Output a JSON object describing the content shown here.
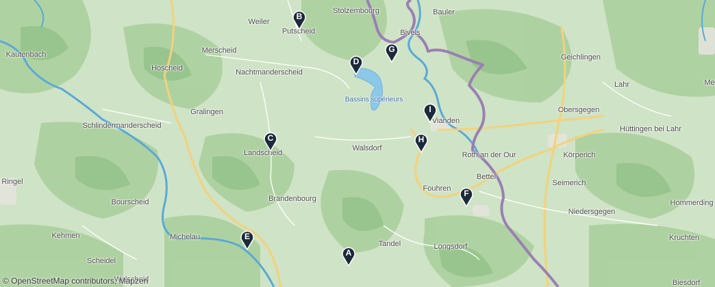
{
  "places": [
    {
      "key": "stolzembourg",
      "name": "Stolzembourg"
    },
    {
      "key": "bauler",
      "name": "Bauler"
    },
    {
      "key": "weiler",
      "name": "Weiler"
    },
    {
      "key": "putscheid",
      "name": "Putscheid"
    },
    {
      "key": "bivels",
      "name": "Bivels"
    },
    {
      "key": "kautenbach",
      "name": "Kautenbach"
    },
    {
      "key": "merscheid",
      "name": "Merscheid"
    },
    {
      "key": "hoscheid",
      "name": "Hoscheid"
    },
    {
      "key": "nachtmanderscheid",
      "name": "Nachtmanderscheid"
    },
    {
      "key": "geichlingen",
      "name": "Geichlingen"
    },
    {
      "key": "lahr",
      "name": "Lahr"
    },
    {
      "key": "bassins",
      "name": "Bassins supérieurs"
    },
    {
      "key": "gralingen",
      "name": "Gralingen"
    },
    {
      "key": "vianden",
      "name": "Vianden"
    },
    {
      "key": "obersgegen",
      "name": "Obersgegen"
    },
    {
      "key": "schlindermanderscheid",
      "name": "Schlindermanderscheid"
    },
    {
      "key": "huttingen",
      "name": "Hüttingen bei Lahr"
    },
    {
      "key": "walsdorf",
      "name": "Walsdorf"
    },
    {
      "key": "landscheid",
      "name": "Landscheid"
    },
    {
      "key": "roth",
      "name": "Roth an der Our"
    },
    {
      "key": "korperich",
      "name": "Körperich"
    },
    {
      "key": "ringel",
      "name": "Ringel"
    },
    {
      "key": "bettel",
      "name": "Bettel"
    },
    {
      "key": "fouhren",
      "name": "Fouhren"
    },
    {
      "key": "seimerich",
      "name": "Seimerich"
    },
    {
      "key": "brandenbourg",
      "name": "Brandenbourg"
    },
    {
      "key": "bourscheid",
      "name": "Bourscheid"
    },
    {
      "key": "hommerding",
      "name": "Hommerding"
    },
    {
      "key": "niedersgegen",
      "name": "Niedersgegen"
    },
    {
      "key": "kehmen",
      "name": "Kehmen"
    },
    {
      "key": "michelau",
      "name": "Michelau"
    },
    {
      "key": "longsdorf",
      "name": "Longsdorf"
    },
    {
      "key": "kruchten",
      "name": "Kruchten"
    },
    {
      "key": "tandel",
      "name": "Tandel"
    },
    {
      "key": "scheidel",
      "name": "Scheidel"
    },
    {
      "key": "welscheid",
      "name": "Welscheid"
    },
    {
      "key": "biesdorf",
      "name": "Biesdorf"
    },
    {
      "key": "me",
      "name": "Me"
    }
  ],
  "markers": [
    {
      "key": "A",
      "label": "A"
    },
    {
      "key": "B",
      "label": "B"
    },
    {
      "key": "C",
      "label": "C"
    },
    {
      "key": "D",
      "label": "D"
    },
    {
      "key": "E",
      "label": "E"
    },
    {
      "key": "F",
      "label": "F"
    },
    {
      "key": "G",
      "label": "G"
    },
    {
      "key": "H",
      "label": "H"
    },
    {
      "key": "I",
      "label": "I"
    }
  ],
  "attribution": "© OpenStreetMap contributors, Mapzen",
  "colors": {
    "land": "#cfe3c6",
    "forest": "#a9cf9b",
    "hill": "#8fbf84",
    "water": "#8cc8e8",
    "river": "#5aa9d6",
    "road_major": "#f3d27a",
    "road_minor": "#ffffff",
    "border": "#9a7fb3",
    "marker": "#1c2a3a"
  }
}
